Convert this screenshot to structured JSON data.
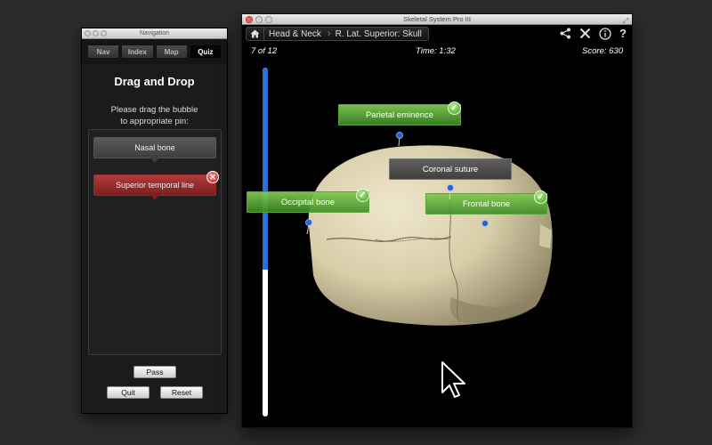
{
  "nav_window": {
    "title": "Navigation",
    "tabs": [
      {
        "label": "Nav",
        "active": false
      },
      {
        "label": "Index",
        "active": false
      },
      {
        "label": "Map",
        "active": false
      },
      {
        "label": "Quiz",
        "active": true
      }
    ],
    "heading": "Drag and Drop",
    "instruction_line1": "Please drag the bubble",
    "instruction_line2": "to appropriate pin:",
    "bubbles": [
      {
        "label": "Nasal bone",
        "state": "neutral"
      },
      {
        "label": "Superior temporal line",
        "state": "wrong"
      }
    ],
    "buttons": {
      "pass": "Pass",
      "quit": "Quit",
      "reset": "Reset"
    }
  },
  "main_window": {
    "title": "Skeletal System Pro III",
    "breadcrumbs": [
      "Head & Neck",
      "R. Lat. Superior: Skull"
    ],
    "toolbar_icons": [
      "share-icon",
      "tools-icon",
      "info-icon",
      "help-icon"
    ],
    "progress_text": "7 of 12",
    "progress_fraction": 0.58,
    "time_text": "Time: 1:32",
    "score_text": "Score: 630",
    "labels": [
      {
        "text": "Parietal eminence",
        "state": "correct"
      },
      {
        "text": "Coronal suture",
        "state": "pending"
      },
      {
        "text": "Occipital bone",
        "state": "correct"
      },
      {
        "text": "Frontal bone",
        "state": "correct"
      }
    ]
  },
  "colors": {
    "correct_green": "#4fa336",
    "wrong_red": "#a52a2a",
    "pin_blue": "#2a63d6",
    "progress_blue": "#2f6fd6"
  }
}
